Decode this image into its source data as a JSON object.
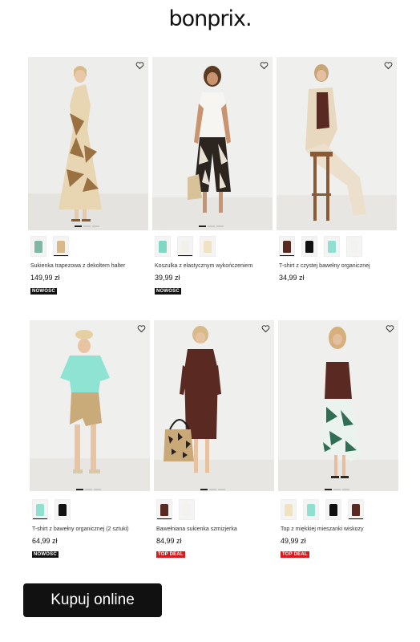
{
  "brand": {
    "logo": "bonprix."
  },
  "products": [
    {
      "name": "Sukienka trapezowa z dekoltem halter",
      "price": "149,99 zł",
      "badge": "NOWOŚĆ",
      "badge_type": "new",
      "swatches": [
        "#7fb7a4",
        "#d9b98a"
      ],
      "selected_swatch": 1
    },
    {
      "name": "Koszulka z elastycznym wykończeniem",
      "price": "39,99 zł",
      "badge": "NOWOŚĆ",
      "badge_type": "new",
      "swatches": [
        "#7fd8c4",
        "#f2f0ea",
        "#efe3c2"
      ],
      "selected_swatch": 1
    },
    {
      "name": "T-shirt z czystej bawełny organicznej",
      "price": "34,99 zł",
      "badge": "",
      "badge_type": "",
      "swatches": [
        "#5a2a22",
        "#111111",
        "#8fe0d0",
        "#f4f2ee"
      ],
      "selected_swatch": 0
    },
    {
      "name": "T-shirt z bawełny organicznej (2 sztuki)",
      "price": "64,99 zł",
      "badge": "NOWOŚĆ",
      "badge_type": "new",
      "swatches": [
        "#8fe0d0",
        "#111111"
      ],
      "selected_swatch": 0
    },
    {
      "name": "Bawełniana sukienka szmizjerka",
      "price": "84,99 zł",
      "badge": "TOP DEAL",
      "badge_type": "deal",
      "swatches": [
        "#5a2a22",
        "#f4f2ee"
      ],
      "selected_swatch": 0
    },
    {
      "name": "Top z miękkiej mieszanki wiskozy",
      "price": "49,99 zł",
      "badge": "TOP DEAL",
      "badge_type": "deal",
      "swatches": [
        "#efe3c2",
        "#8fe0d0",
        "#111111",
        "#5a2a22"
      ],
      "selected_swatch": 3
    }
  ],
  "cta": {
    "label": "Kupuj online"
  },
  "colors": {
    "ink": "#111111",
    "deal": "#d31c1c",
    "photo_bg": "#ececea"
  }
}
